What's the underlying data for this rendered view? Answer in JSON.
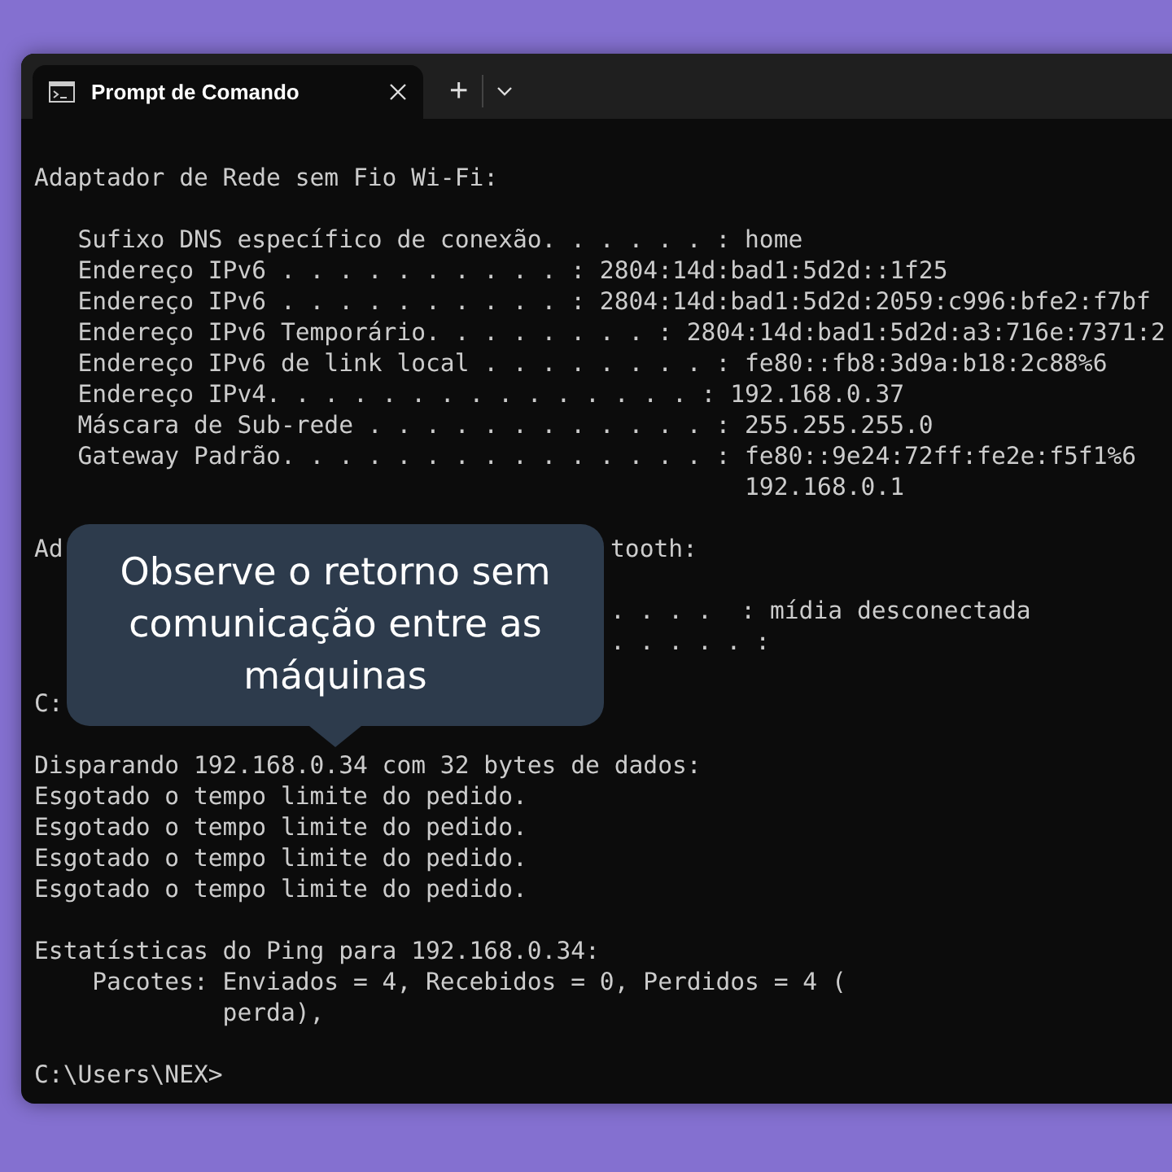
{
  "window": {
    "tabs": [
      {
        "title": "Prompt de Comando",
        "selected": true
      }
    ],
    "new_tab": "+"
  },
  "terminal": {
    "lines": [
      {
        "kind": "blank"
      },
      {
        "kind": "text",
        "text": "Adaptador de Rede sem Fio Wi-Fi:"
      },
      {
        "kind": "blank"
      },
      {
        "kind": "text",
        "text": "   Sufixo DNS específico de conexão. . . . . . : home"
      },
      {
        "kind": "text",
        "text": "   Endereço IPv6 . . . . . . . . . . : 2804:14d:bad1:5d2d::1f25"
      },
      {
        "kind": "text",
        "text": "   Endereço IPv6 . . . . . . . . . . : 2804:14d:bad1:5d2d:2059:c996:bfe2:f7bf"
      },
      {
        "kind": "text",
        "text": "   Endereço IPv6 Temporário. . . . . . . . : 2804:14d:bad1:5d2d:a3:716e:7371:2"
      },
      {
        "kind": "text",
        "text": "   Endereço IPv6 de link local . . . . . . . . : fe80::fb8:3d9a:b18:2c88%6"
      },
      {
        "kind": "text",
        "text": "   Endereço IPv4. . . . . . . . . . . . . . . : 192.168.0.37"
      },
      {
        "kind": "text",
        "text": "   Máscara de Sub-rede . . . . . . . . . . . . : 255.255.255.0"
      },
      {
        "kind": "text",
        "text": "   Gateway Padrão. . . . . . . . . . . . . . . : fe80::9e24:72ff:fe2e:f5f1%6"
      },
      {
        "kind": "text",
        "text": "                                                 192.168.0.1"
      },
      {
        "kind": "blank"
      },
      {
        "kind": "covered",
        "left": "Ad",
        "right": "tooth:"
      },
      {
        "kind": "blank"
      },
      {
        "kind": "covered",
        "right": ". . . .  : mídia desconectada"
      },
      {
        "kind": "covered",
        "right": ". . . . . :"
      },
      {
        "kind": "blank"
      },
      {
        "kind": "covered",
        "left": "C:"
      },
      {
        "kind": "blank"
      },
      {
        "kind": "text",
        "text": "Disparando 192.168.0.34 com 32 bytes de dados:"
      },
      {
        "kind": "text",
        "text": "Esgotado o tempo limite do pedido."
      },
      {
        "kind": "text",
        "text": "Esgotado o tempo limite do pedido."
      },
      {
        "kind": "text",
        "text": "Esgotado o tempo limite do pedido."
      },
      {
        "kind": "text",
        "text": "Esgotado o tempo limite do pedido."
      },
      {
        "kind": "blank"
      },
      {
        "kind": "text",
        "text": "Estatísticas do Ping para 192.168.0.34:"
      },
      {
        "kind": "text",
        "text": "    Pacotes: Enviados = 4, Recebidos = 0, Perdidos = 4 ("
      },
      {
        "kind": "text",
        "text": "             perda),"
      },
      {
        "kind": "blank"
      },
      {
        "kind": "text",
        "text": "C:\\Users\\NEX>"
      }
    ]
  },
  "callout": {
    "text": "Observe o retorno sem comunicação entre as máquinas"
  }
}
